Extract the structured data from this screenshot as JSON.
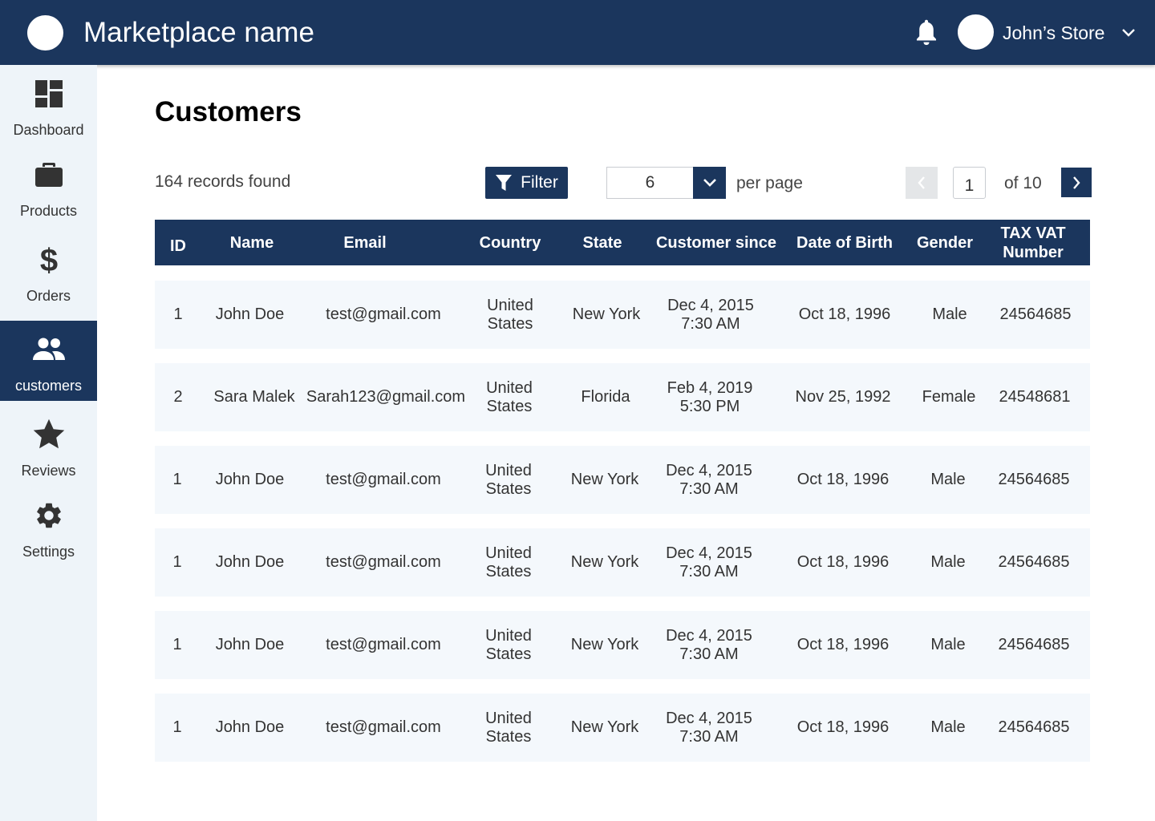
{
  "header": {
    "app_title": "Marketplace name",
    "store_name": "John’s Store",
    "icons": {
      "notifications": "bell-icon",
      "store_menu": "chevron-down-icon"
    },
    "colors": {
      "primary": "#1b365d",
      "sidebar_bg": "#eef4f9",
      "row_bg": "#f4f8fc"
    }
  },
  "sidebar": {
    "items": [
      {
        "label": "Dashboard",
        "icon": "dashboard-icon",
        "active": false
      },
      {
        "label": "Products",
        "icon": "briefcase-icon",
        "active": false
      },
      {
        "label": "Orders",
        "icon": "dollar-icon",
        "active": false
      },
      {
        "label": "customers",
        "icon": "people-icon",
        "active": true
      },
      {
        "label": "Reviews",
        "icon": "star-icon",
        "active": false
      },
      {
        "label": "Settings",
        "icon": "gear-icon",
        "active": false
      }
    ]
  },
  "main": {
    "page_title": "Customers",
    "records_found": "164 records found",
    "filter_label": "Filter",
    "per_page_value": "6",
    "per_page_label": "per page",
    "pagination": {
      "current_page": "1",
      "of_label": "of 10"
    }
  },
  "table": {
    "columns": [
      "ID",
      "Name",
      "Email",
      "Country",
      "State",
      "Customer since",
      "Date of Birth",
      "Gender",
      "TAX VAT Number"
    ],
    "rows": [
      {
        "id": "1",
        "name": "John Doe",
        "email": "test@gmail.com",
        "country": "United States",
        "state": "New York",
        "since_date": "Dec 4, 2015",
        "since_time": "7:30 AM",
        "dob": "Oct 18, 1996",
        "gender": "Male",
        "tax": "24564685"
      },
      {
        "id": "2",
        "name": "Sara Malek",
        "email": "Sarah123@gmail.com",
        "country": "United States",
        "state": "Florida",
        "since_date": "Feb 4, 2019",
        "since_time": "5:30 PM",
        "dob": "Nov 25, 1992",
        "gender": "Female",
        "tax": "24548681"
      },
      {
        "id": "1",
        "name": "John Doe",
        "email": "test@gmail.com",
        "country": "United States",
        "state": "New York",
        "since_date": "Dec 4, 2015",
        "since_time": "7:30 AM",
        "dob": "Oct 18, 1996",
        "gender": "Male",
        "tax": "24564685"
      },
      {
        "id": "1",
        "name": "John Doe",
        "email": "test@gmail.com",
        "country": "United States",
        "state": "New York",
        "since_date": "Dec 4, 2015",
        "since_time": "7:30 AM",
        "dob": "Oct 18, 1996",
        "gender": "Male",
        "tax": "24564685"
      },
      {
        "id": "1",
        "name": "John Doe",
        "email": "test@gmail.com",
        "country": "United States",
        "state": "New York",
        "since_date": "Dec 4, 2015",
        "since_time": "7:30 AM",
        "dob": "Oct 18, 1996",
        "gender": "Male",
        "tax": "24564685"
      },
      {
        "id": "1",
        "name": "John Doe",
        "email": "test@gmail.com",
        "country": "United States",
        "state": "New York",
        "since_date": "Dec 4, 2015",
        "since_time": "7:30 AM",
        "dob": "Oct 18, 1996",
        "gender": "Male",
        "tax": "24564685"
      }
    ]
  }
}
